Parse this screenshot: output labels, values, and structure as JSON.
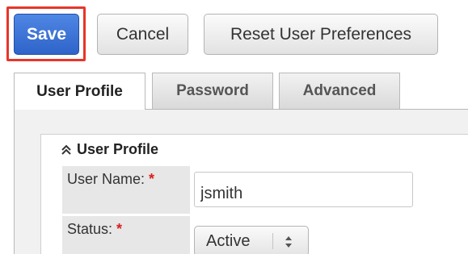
{
  "toolbar": {
    "save_label": "Save",
    "cancel_label": "Cancel",
    "reset_label": "Reset User Preferences"
  },
  "tabs": [
    {
      "label": "User Profile",
      "active": true
    },
    {
      "label": "Password",
      "active": false
    },
    {
      "label": "Advanced",
      "active": false
    }
  ],
  "section": {
    "title": "User Profile",
    "collapse_icon": "double-chevron-up-icon"
  },
  "fields": {
    "user_name": {
      "label": "User Name:",
      "required_mark": "*",
      "value": "jsmith"
    },
    "status": {
      "label": "Status:",
      "required_mark": "*",
      "selected": "Active",
      "icon": "select-arrows-icon"
    }
  },
  "colors": {
    "highlight": "#e8352a",
    "save_button": "#3a6fd6",
    "required": "#d9201d"
  }
}
